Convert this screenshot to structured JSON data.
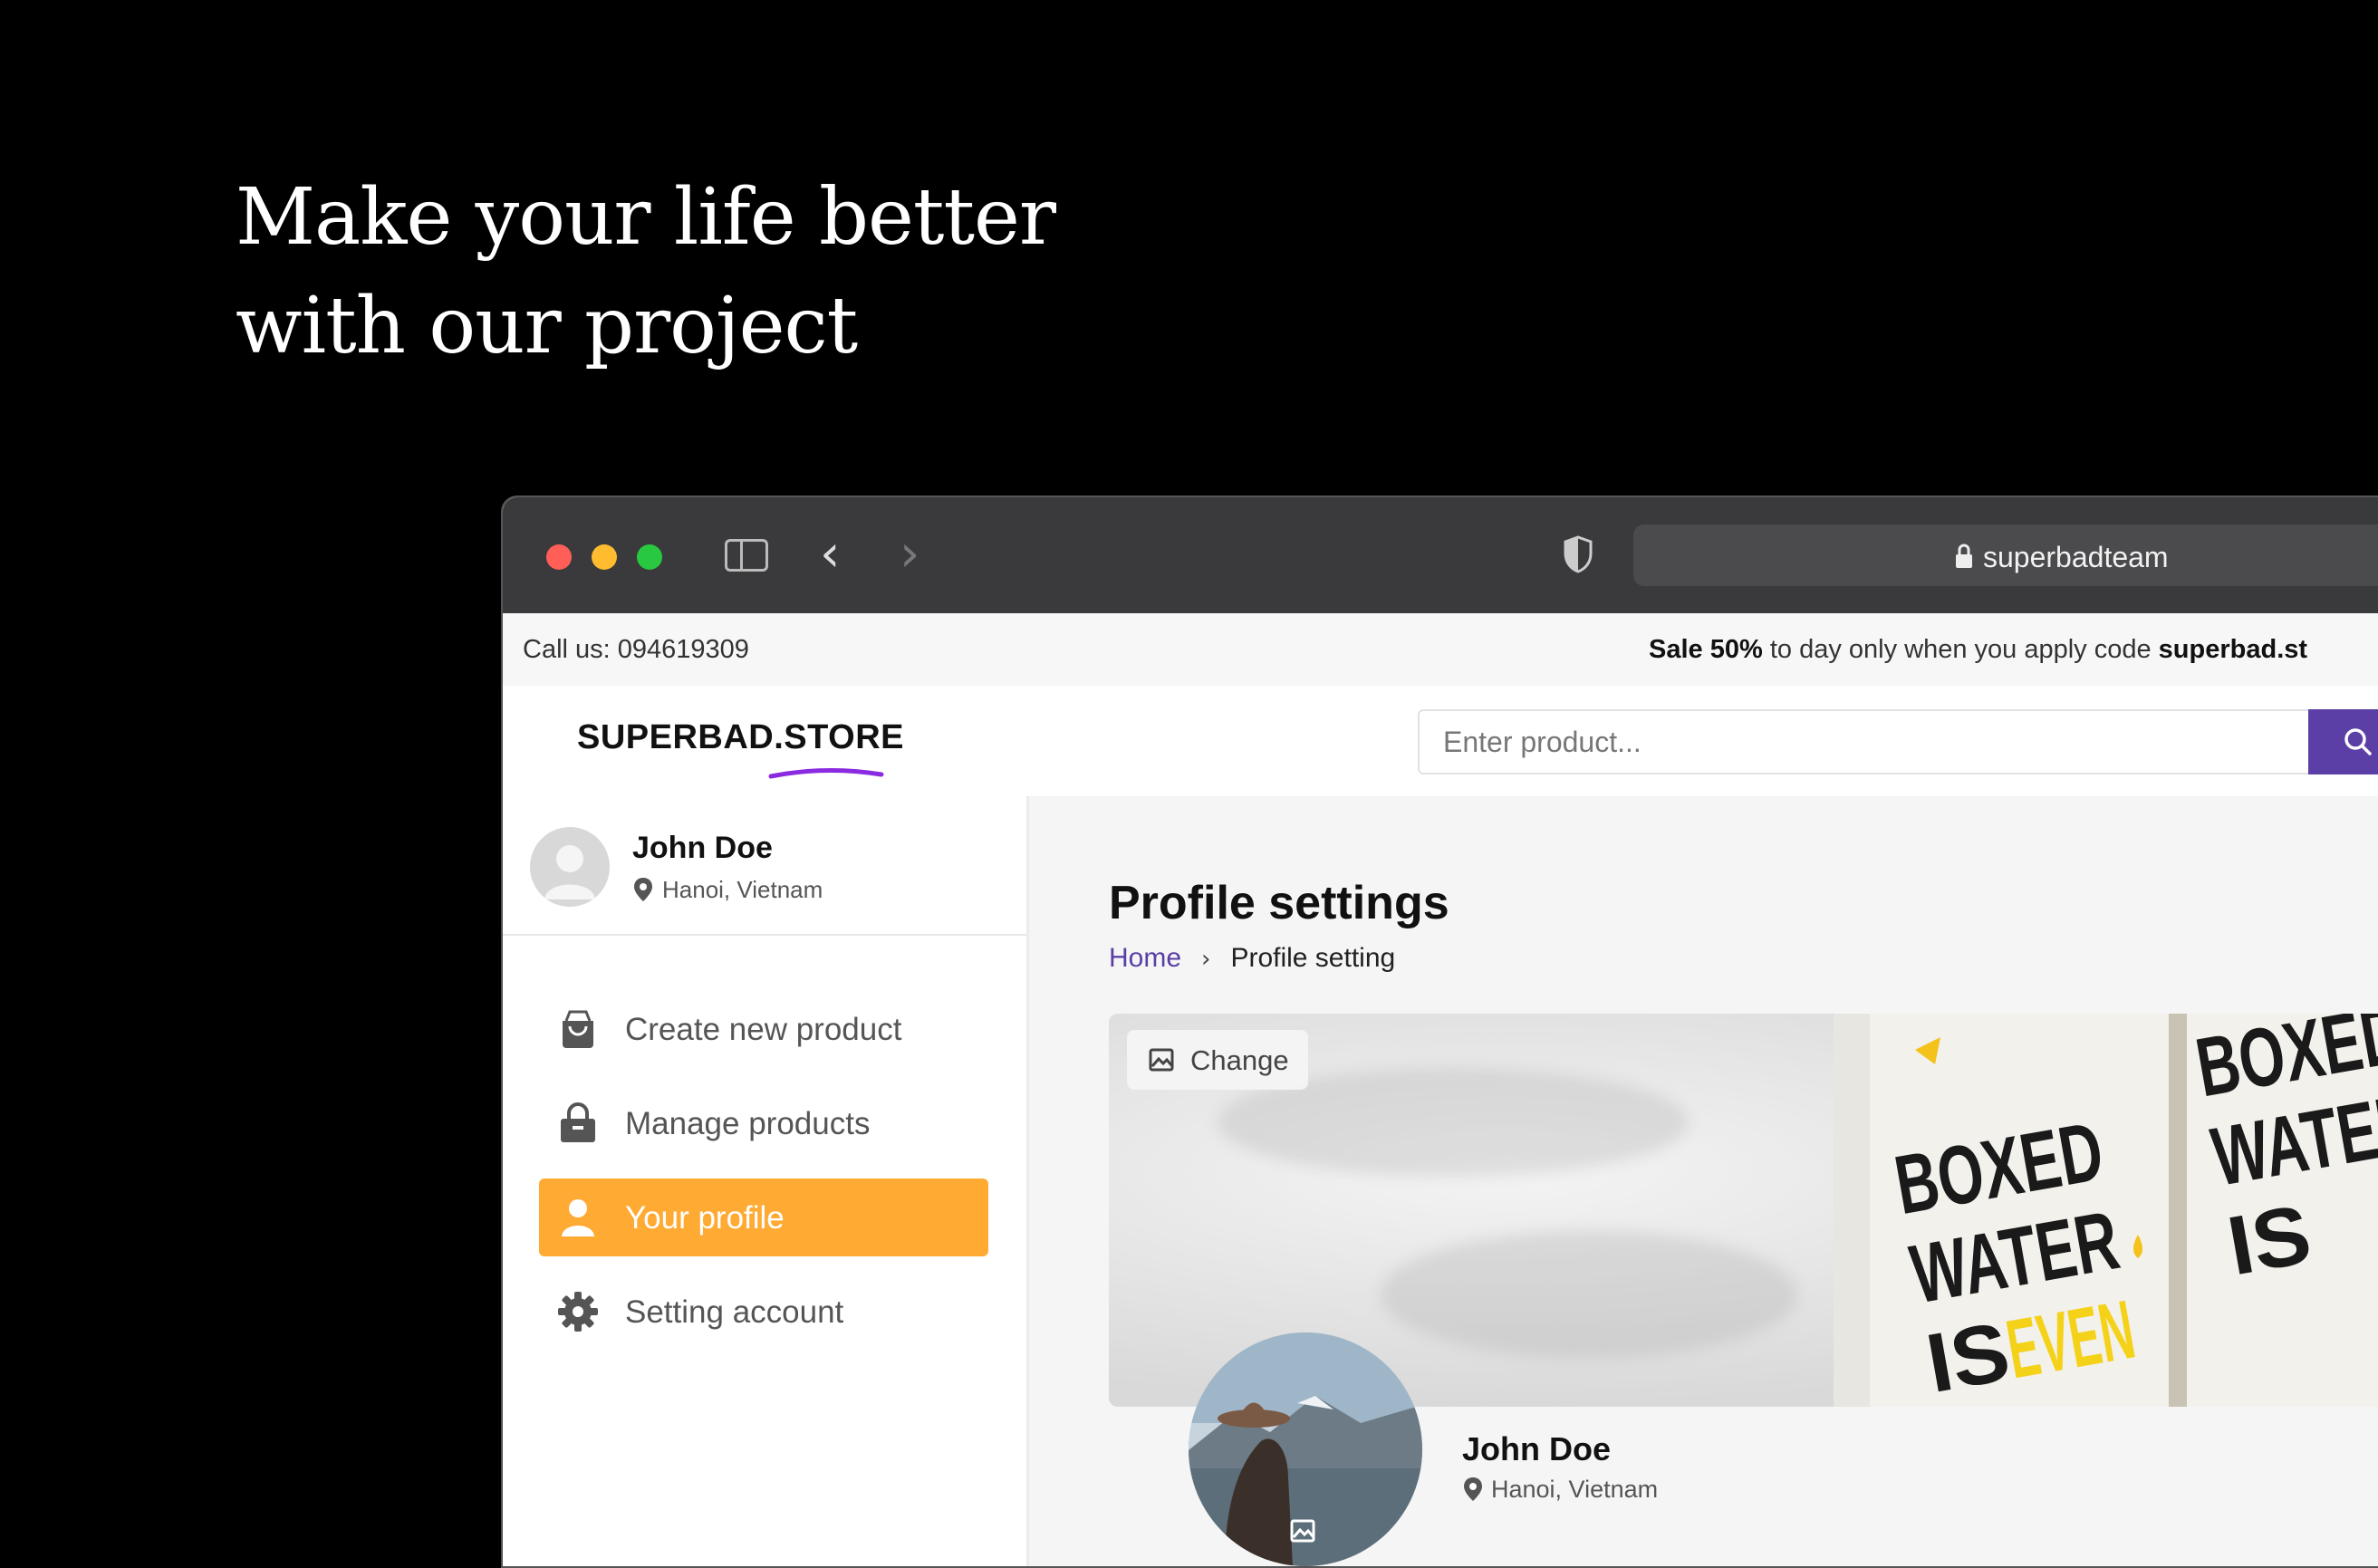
{
  "headline": {
    "line1": "Make your life better",
    "line2": "with our project"
  },
  "browser": {
    "url": "superbadteam"
  },
  "topbar": {
    "call": "Call us: 094619309",
    "sale_prefix": "Sale 50%",
    "sale_mid": " to day only when you apply code ",
    "sale_code": "superbad.st"
  },
  "header": {
    "logo": "SUPERBAD.STORE",
    "search_placeholder": "Enter product..."
  },
  "user": {
    "name": "John Doe",
    "location": "Hanoi, Vietnam"
  },
  "menu": [
    {
      "label": "Create new product",
      "icon": "shopping-bag-icon"
    },
    {
      "label": "Manage products",
      "icon": "lock-bag-icon"
    },
    {
      "label": "Your profile",
      "icon": "user-icon",
      "active": true
    },
    {
      "label": "Setting account",
      "icon": "gear-icon"
    }
  ],
  "main": {
    "title": "Profile settings",
    "breadcrumb": {
      "home": "Home",
      "current": "Profile setting"
    },
    "cover": {
      "change_label": "Change"
    },
    "profile": {
      "name": "John Doe",
      "location": "Hanoi, Vietnam"
    }
  },
  "colors": {
    "accent": "#5b3fa6",
    "active": "#ffaa33"
  }
}
